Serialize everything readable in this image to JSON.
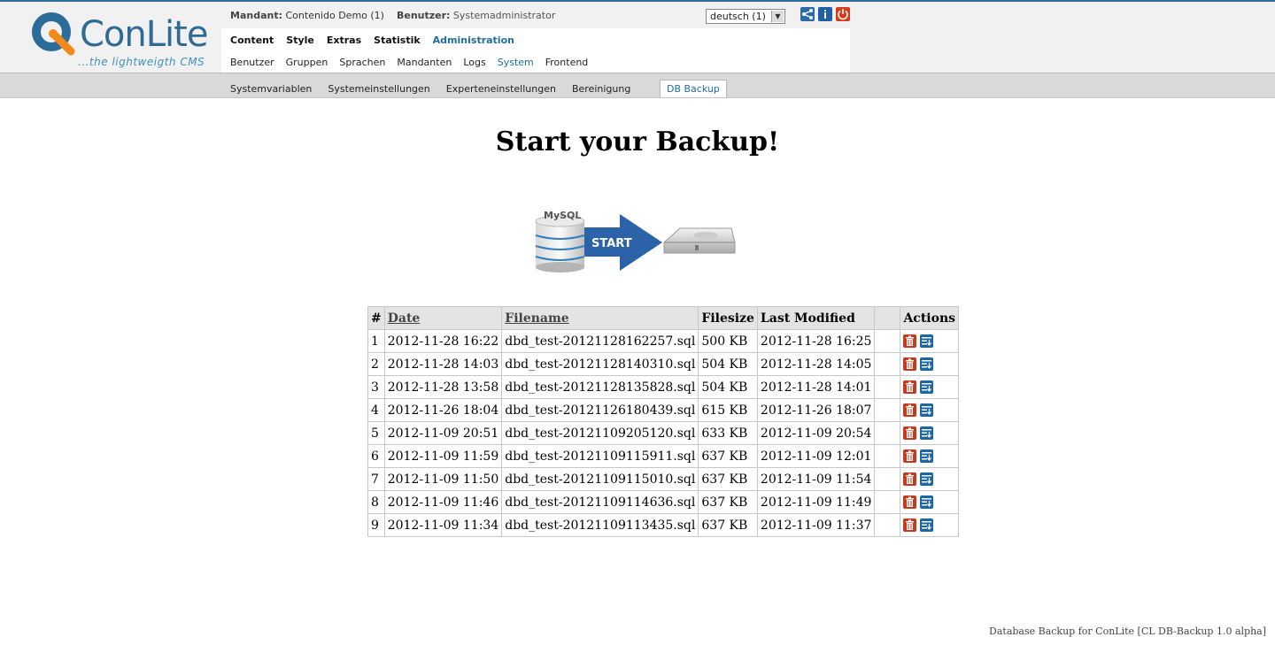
{
  "app": {
    "logo_text": "ConLite",
    "logo_sub": "...the lightweigth CMS"
  },
  "header": {
    "mandant_label": "Mandant:",
    "mandant_value": "Contenido Demo (1)",
    "benutzer_label": "Benutzer:",
    "benutzer_value": "Systemadministrator",
    "language_select": "deutsch (1)"
  },
  "mainnav": [
    "Content",
    "Style",
    "Extras",
    "Statistik",
    "Administration"
  ],
  "subnav": [
    "Benutzer",
    "Gruppen",
    "Sprachen",
    "Mandanten",
    "Logs",
    "System",
    "Frontend"
  ],
  "tabs": [
    "Systemvariablen",
    "Systemeinstellungen",
    "Experteneinstellungen",
    "Bereinigung"
  ],
  "active_tab": "DB Backup",
  "page_title": "Start your Backup!",
  "start_graphic": {
    "db_label": "MySQL",
    "arrow_label": "START"
  },
  "table": {
    "headers": [
      "#",
      "Date",
      "Filename",
      "Filesize",
      "Last Modified",
      "",
      "Actions"
    ],
    "rows": [
      [
        "1",
        "2012-11-28 16:22",
        "dbd_test-20121128162257.sql",
        "500 KB",
        "2012-11-28 16:25"
      ],
      [
        "2",
        "2012-11-28 14:03",
        "dbd_test-20121128140310.sql",
        "504 KB",
        "2012-11-28 14:05"
      ],
      [
        "3",
        "2012-11-28 13:58",
        "dbd_test-20121128135828.sql",
        "504 KB",
        "2012-11-28 14:01"
      ],
      [
        "4",
        "2012-11-26 18:04",
        "dbd_test-20121126180439.sql",
        "615 KB",
        "2012-11-26 18:07"
      ],
      [
        "5",
        "2012-11-09 20:51",
        "dbd_test-20121109205120.sql",
        "633 KB",
        "2012-11-09 20:54"
      ],
      [
        "6",
        "2012-11-09 11:59",
        "dbd_test-20121109115911.sql",
        "637 KB",
        "2012-11-09 12:01"
      ],
      [
        "7",
        "2012-11-09 11:50",
        "dbd_test-20121109115010.sql",
        "637 KB",
        "2012-11-09 11:54"
      ],
      [
        "8",
        "2012-11-09 11:46",
        "dbd_test-20121109114636.sql",
        "637 KB",
        "2012-11-09 11:49"
      ],
      [
        "9",
        "2012-11-09 11:34",
        "dbd_test-20121109113435.sql",
        "637 KB",
        "2012-11-09 11:37"
      ]
    ]
  },
  "footer": "Database Backup for ConLite [CL DB-Backup 1.0 alpha]",
  "colors": {
    "accent": "#1f6f9c",
    "delete": "#c9391c",
    "restore": "#1a66a8",
    "power": "#d63b1f"
  },
  "icons": {
    "share": "share-icon",
    "info": "info-icon",
    "power": "power-icon",
    "delete": "trash-icon",
    "restore": "restore-icon"
  }
}
